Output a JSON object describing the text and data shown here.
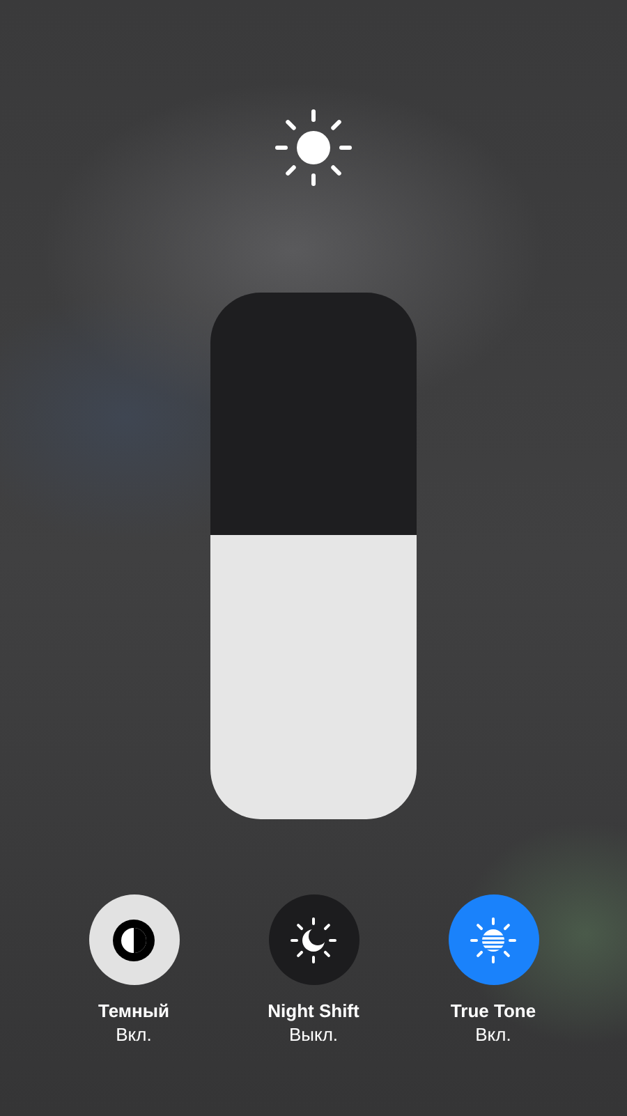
{
  "brightness": {
    "level": 0.54
  },
  "toggles": [
    {
      "kind": "appearance",
      "label": "Темный",
      "status": "Вкл.",
      "on": true
    },
    {
      "kind": "night_shift",
      "label": "Night Shift",
      "status": "Выкл.",
      "on": false
    },
    {
      "kind": "true_tone",
      "label": "True Tone",
      "status": "Вкл.",
      "on": true
    }
  ]
}
